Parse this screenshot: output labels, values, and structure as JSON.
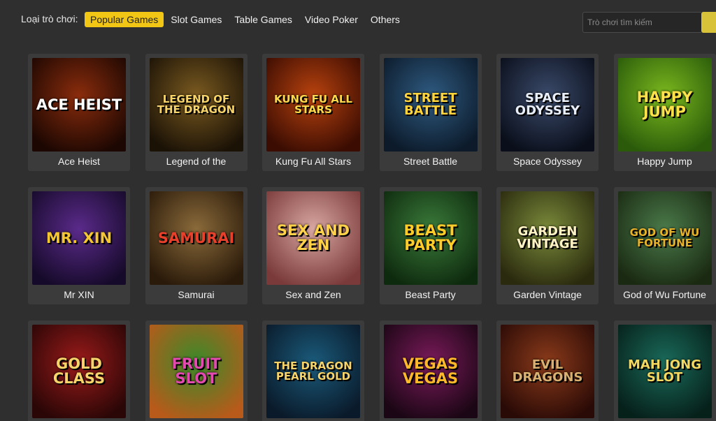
{
  "filter": {
    "label": "Loại trò chơi:",
    "tabs": [
      "Popular Games",
      "Slot Games",
      "Table Games",
      "Video Poker",
      "Others"
    ],
    "active": "Popular Games"
  },
  "search": {
    "placeholder": "Trò chơi tìm kiếm"
  },
  "colors": {
    "accent": "#f2c614",
    "background": "#2f2f2f",
    "card": "#3b3b3b"
  },
  "games": [
    {
      "name": "Ace Heist",
      "art_text": "ACE HEIST",
      "bg": "#8a2c0c",
      "bg2": "#1c0702",
      "fg": "#ffffff"
    },
    {
      "name": "Legend of the",
      "art_text": "LEGEND OF THE DRAGON",
      "bg": "#7a5a20",
      "bg2": "#1b1206",
      "fg": "#f6d46a"
    },
    {
      "name": "Kung Fu All Stars",
      "art_text": "KUNG FU ALL STARS",
      "bg": "#b8420e",
      "bg2": "#3a0c02",
      "fg": "#ffd94a"
    },
    {
      "name": "Street Battle",
      "art_text": "STREET BATTLE",
      "bg": "#2e5a80",
      "bg2": "#0c1a2a",
      "fg": "#ffd43a"
    },
    {
      "name": "Space Odyssey",
      "art_text": "SPACE ODYSSEY",
      "bg": "#3a4a6a",
      "bg2": "#0a0e1a",
      "fg": "#e8eef8"
    },
    {
      "name": "Happy Jump",
      "art_text": "HAPPY JUMP",
      "bg": "#7ab81e",
      "bg2": "#2a5a0a",
      "fg": "#ffe14a"
    },
    {
      "name": "Mr XIN",
      "art_text": "MR. XIN",
      "bg": "#5a2a8a",
      "bg2": "#160a2a",
      "fg": "#f4c632"
    },
    {
      "name": "Samurai",
      "art_text": "SAMURAI",
      "bg": "#8a6a3a",
      "bg2": "#2a1a0a",
      "fg": "#e8402a"
    },
    {
      "name": "Sex and Zen",
      "art_text": "SEX AND ZEN",
      "bg": "#d8a6a0",
      "bg2": "#7a3a3a",
      "fg": "#ffd24a"
    },
    {
      "name": "Beast Party",
      "art_text": "BEAST PARTY",
      "bg": "#3a7a3a",
      "bg2": "#0e2a0e",
      "fg": "#ffcc2a"
    },
    {
      "name": "Garden Vintage",
      "art_text": "GARDEN VINTAGE",
      "bg": "#7a8a3a",
      "bg2": "#2a2a0e",
      "fg": "#fff2c4"
    },
    {
      "name": "God of Wu Fortune",
      "art_text": "GOD OF WU FORTUNE",
      "bg": "#4a7a4a",
      "bg2": "#1a2a12",
      "fg": "#e8b228"
    },
    {
      "name": "",
      "art_text": "GOLD CLASS",
      "bg": "#9a1a1a",
      "bg2": "#2a0606",
      "fg": "#f6d46a"
    },
    {
      "name": "",
      "art_text": "FRUIT SLOT",
      "bg": "#3a8a2a",
      "bg2": "#b85a1a",
      "fg": "#e24ab0"
    },
    {
      "name": "",
      "art_text": "THE DRAGON PEARL GOLD",
      "bg": "#1a5a7a",
      "bg2": "#0a1a2a",
      "fg": "#f6d46a"
    },
    {
      "name": "",
      "art_text": "VEGAS VEGAS",
      "bg": "#7a1a5a",
      "bg2": "#1a0614",
      "fg": "#ffb82a"
    },
    {
      "name": "",
      "art_text": "EVIL DRAGONS",
      "bg": "#8a3a1a",
      "bg2": "#2a0a06",
      "fg": "#d8b070"
    },
    {
      "name": "",
      "art_text": "MAH JONG SLOT",
      "bg": "#1a6a5a",
      "bg2": "#06201a",
      "fg": "#f2d860"
    }
  ]
}
